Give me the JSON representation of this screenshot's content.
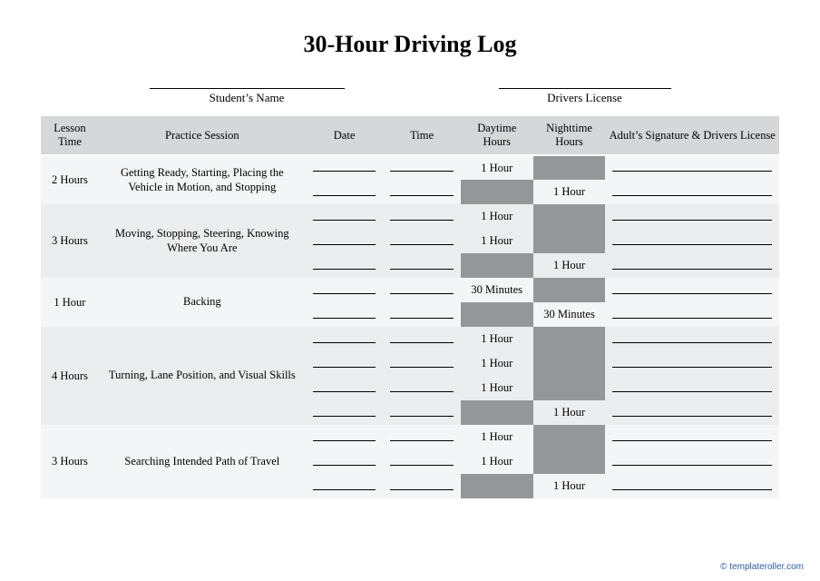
{
  "title": "30-Hour Driving Log",
  "fields": {
    "student": "Student’s Name",
    "license": "Drivers License"
  },
  "headers": {
    "lesson": "Lesson Time",
    "session": "Practice Session",
    "date": "Date",
    "time": "Time",
    "day": "Daytime Hours",
    "night": "Nighttime Hours",
    "sig": "Adult’s Signature & Drivers License"
  },
  "groups": [
    {
      "shade": "g-odd",
      "lesson": "2 Hours",
      "session": "Getting Ready, Starting, Placing the Vehicle in Motion, and Stopping",
      "rows": [
        {
          "day": "1 Hour",
          "night": ""
        },
        {
          "day": "",
          "night": "1 Hour"
        }
      ]
    },
    {
      "shade": "g-even",
      "lesson": "3 Hours",
      "session": "Moving, Stopping, Steering, Knowing Where You Are",
      "rows": [
        {
          "day": "1 Hour",
          "night": ""
        },
        {
          "day": "1 Hour",
          "night": ""
        },
        {
          "day": "",
          "night": "1 Hour"
        }
      ]
    },
    {
      "shade": "g-odd",
      "lesson": "1 Hour",
      "session": "Backing",
      "rows": [
        {
          "day": "30 Minutes",
          "night": ""
        },
        {
          "day": "",
          "night": "30 Minutes"
        }
      ]
    },
    {
      "shade": "g-even",
      "lesson": "4 Hours",
      "session": "Turning, Lane Position, and Visual Skills",
      "rows": [
        {
          "day": "1 Hour",
          "night": ""
        },
        {
          "day": "1 Hour",
          "night": ""
        },
        {
          "day": "1 Hour",
          "night": ""
        },
        {
          "day": "",
          "night": "1 Hour"
        }
      ]
    },
    {
      "shade": "g-odd",
      "lesson": "3 Hours",
      "session": "Searching Intended Path of Travel",
      "rows": [
        {
          "day": "1 Hour",
          "night": ""
        },
        {
          "day": "1 Hour",
          "night": ""
        },
        {
          "day": "",
          "night": "1 Hour"
        }
      ]
    }
  ],
  "credit": "© templateroller.com"
}
